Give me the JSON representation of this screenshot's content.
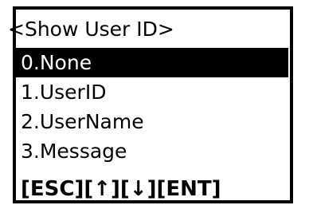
{
  "screen": {
    "title": "<Show User ID>",
    "menu_items": [
      {
        "label": "0.None",
        "selected": true
      },
      {
        "label": "1.UserID",
        "selected": false
      },
      {
        "label": "2.UserName",
        "selected": false
      },
      {
        "label": "3.Message",
        "selected": false
      }
    ],
    "key_hints": [
      "[ESC]",
      "[↑]",
      "[↓]",
      "[ENT]"
    ]
  },
  "colors": {
    "background": "#ffffff",
    "foreground": "#000000",
    "highlight": "#000000"
  }
}
